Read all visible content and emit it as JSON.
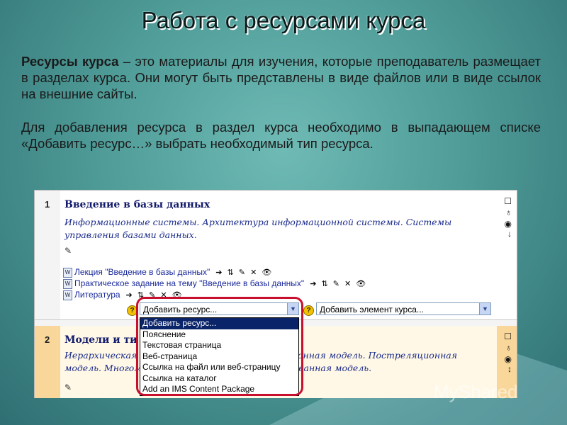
{
  "slide": {
    "title": "Работа с ресурсами курса",
    "para1_bold": "Ресурсы курса",
    "para1_rest": " – это материалы для изучения, которые преподаватель размещает в разделах курса. Они могут быть представлены в виде файлов или в виде ссылок на внешние сайты.",
    "para2": "Для добавления ресурса в раздел курса необходимо в выпадающем списке «Добавить ресурс…» выбрать необходимый тип ресурса."
  },
  "course": {
    "section1": {
      "number": "1",
      "heading": "Введение в базы данных",
      "description": "Информационные системы. Архитектура информационной системы. Системы управления базами данных.",
      "resources": [
        {
          "label": "Лекция \"Введение в базы данных\""
        },
        {
          "label": "Практическое задание на тему \"Введение в базы данных\""
        },
        {
          "label": "Литература"
        }
      ],
      "add_resource_select": "Добавить ресурс...",
      "add_activity_select": "Добавить элемент курса..."
    },
    "section2": {
      "number": "2",
      "heading": "Модели и ти",
      "description_left": "Иерархическая",
      "description_right": "ционная модель. Постреляционная",
      "description_line2_left": "модель. Многом",
      "description_line2_right": "ованная модель."
    },
    "dropdown_options": [
      "Добавить ресурс...",
      "Пояснение",
      "Текстовая страница",
      "Веб-страница",
      "Ссылка на файл или веб-страницу",
      "Ссылка на каталог",
      "Add an IMS Content Package"
    ],
    "tool_icons": "➔ ⇅ ✎ ✕ 👁"
  },
  "watermark": "MyShared",
  "colors": {
    "highlight_ring": "#c8102e",
    "selected_option": "#0a246a",
    "section2_accent": "#f9d79a"
  }
}
